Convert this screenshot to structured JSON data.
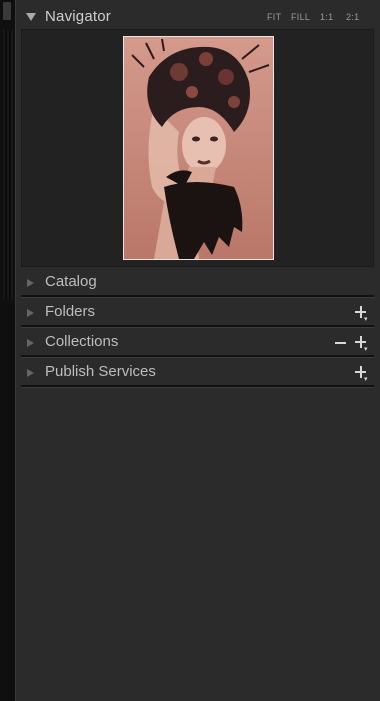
{
  "navigator": {
    "title": "Navigator",
    "zoom": {
      "fit": "FIT",
      "fill": "FILL",
      "one_to_one": "1:1",
      "two_to_one": "2:1"
    }
  },
  "sections": [
    {
      "label": "Catalog"
    },
    {
      "label": "Folders"
    },
    {
      "label": "Collections"
    },
    {
      "label": "Publish Services"
    }
  ],
  "colors": {
    "panel_bg": "#2b2b2b",
    "text": "#cfcfcf",
    "preview_tint": "#c98b7d"
  }
}
